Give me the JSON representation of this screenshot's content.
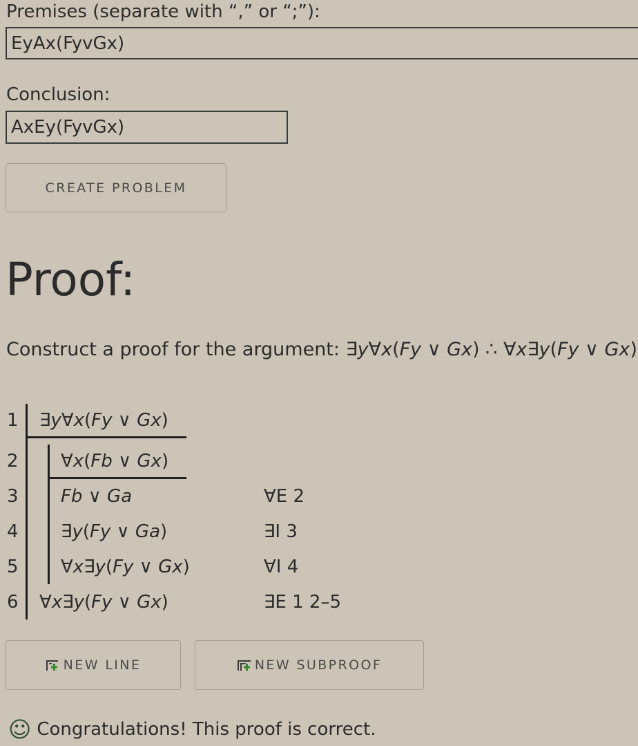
{
  "premises": {
    "label": "Premises (separate with “,” or “;”):",
    "value": "EyAx(FyvGx)"
  },
  "conclusion": {
    "label": "Conclusion:",
    "value": "AxEy(FyvGx)"
  },
  "create_button": "CREATE PROBLEM",
  "proof_heading": "Proof:",
  "prompt": {
    "text": "Construct a proof for the argument: ",
    "premise": "∃y∀x(Fy ∨ Gx)",
    "therefore": "∴",
    "conclusion": "∀x∃y(Fy ∨ Gx)"
  },
  "lines": [
    {
      "num": "1",
      "formula": "∃y∀x(Fy ∨ Gx)",
      "justification": ""
    },
    {
      "num": "2",
      "formula": "∀x(Fb ∨ Gx)",
      "justification": ""
    },
    {
      "num": "3",
      "formula": "Fb ∨ Ga",
      "justification": "∀E 2"
    },
    {
      "num": "4",
      "formula": "∃y(Fy ∨ Ga)",
      "justification": "∃I 3"
    },
    {
      "num": "5",
      "formula": "∀x∃y(Fy ∨ Gx)",
      "justification": "∀I 4"
    },
    {
      "num": "6",
      "formula": "∀x∃y(Fy ∨ Gx)",
      "justification": "∃E 1 2–5"
    }
  ],
  "buttons": {
    "new_line": "NEW LINE",
    "new_subproof": "NEW SUBPROOF"
  },
  "status": {
    "icon": "smiley-icon",
    "message": "Congratulations! This proof is correct."
  },
  "colors": {
    "background": "#ccc4b6",
    "text": "#2b2b2b",
    "icon_green": "#2e8b2e"
  }
}
